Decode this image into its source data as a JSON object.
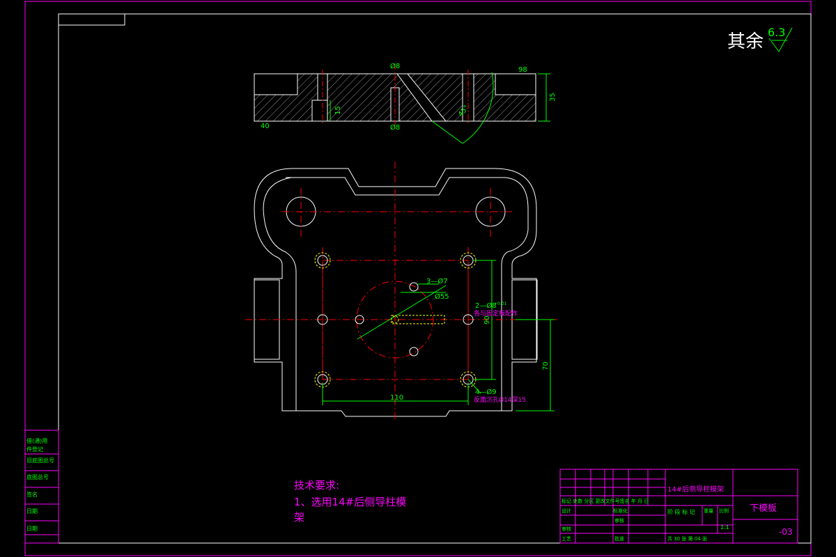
{
  "drawing": {
    "surface_finish": {
      "prefix": "其余",
      "value": "6.3"
    },
    "tech_requirements": {
      "heading": "技术要求:",
      "line1": "1、选用14#后侧导柱模",
      "line2": "架"
    },
    "section_view": {
      "dim_phi8": "Ø8",
      "dim_98": "98",
      "dim_35": "35",
      "dim_15": "15",
      "dim_40": "40",
      "dim_angle": "45°"
    },
    "plan_view": {
      "note_3holes": "3—Ø7",
      "note_phi55": "Ø55",
      "note_2holes": "2—Ø8",
      "note_2holes_sup": "+0.01",
      "note_pin": "各与固定板配作",
      "dim_90": "90",
      "dim_70": "70",
      "dim_110": "110",
      "note_4holes": "4—Ø9",
      "note_counterbore": "反面沉孔Ø14深15"
    },
    "side_block": {
      "labels": [
        "借(通)用",
        "件登记",
        "旧底图总号",
        "底图总号",
        "签名",
        "日期",
        "日期"
      ]
    },
    "title_block": {
      "drawing_title": "14#后侧导柱模架",
      "part_name": "下模板",
      "drawing_no": "-03",
      "scale_label": "比例",
      "scale": "1:1",
      "weight_label": "重量",
      "stage_label": "阶 段 标 记",
      "biaozhunhua": "标准化",
      "rev_header": "标记 处数 分区 更改文件号签名 年 月 日",
      "design": "设计",
      "review": "审核",
      "process": "工艺",
      "approve": "批准",
      "check": "审核",
      "sheets": "共 30 张 第 04 张"
    }
  },
  "colors": {
    "border": "#ff00ff",
    "geometry": "#ffffff",
    "centerline": "#ff0000",
    "dimension": "#00ff00",
    "hidden": "#ffff00",
    "annotation": "#ff00ff"
  }
}
